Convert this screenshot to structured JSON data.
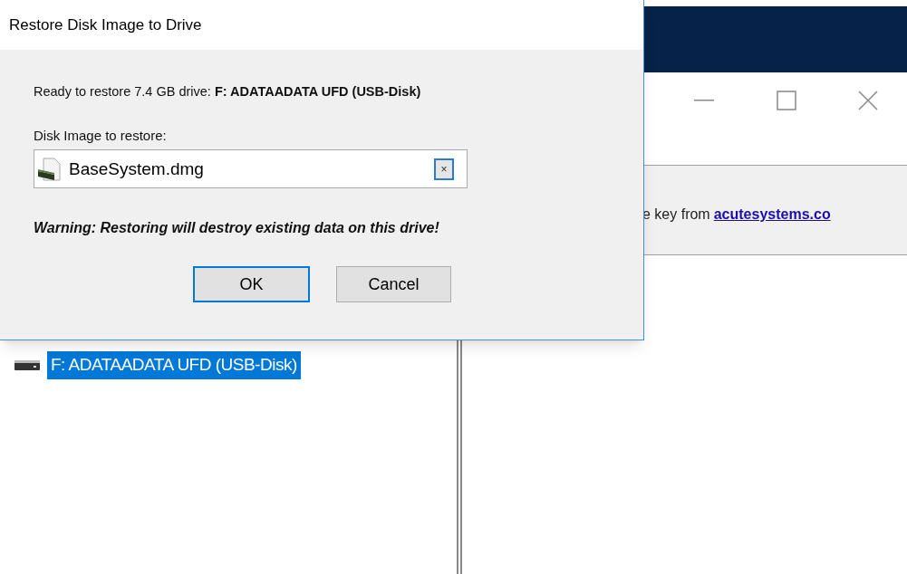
{
  "dialog": {
    "title": "Restore Disk Image to Drive",
    "ready_text": "Ready to restore 7.4 GB drive: **F: ADATAADATA UFD (USB-Disk)**",
    "image_label": "Disk Image to restore:",
    "image_file": "BaseSystem.dmg",
    "clear_button": "×",
    "warning": "Warning: Restoring will destroy existing data on this drive!",
    "buttons": [
      {
        "label": "OK",
        "default": true
      },
      {
        "label": "Cancel",
        "default": false
      }
    ]
  },
  "main_window": {
    "notice_text": "e key from",
    "notice_link": "acutesystems.co",
    "drives": [
      {
        "label": "F: ADATAADATA UFD (USB-Disk)",
        "selected": true
      }
    ]
  }
}
